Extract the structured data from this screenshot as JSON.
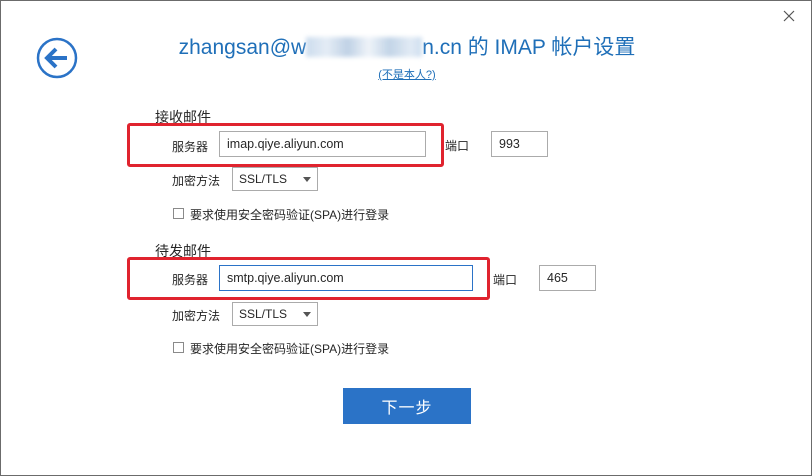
{
  "header": {
    "title_prefix": "zhangsan@w",
    "title_suffix": "n.cn 的 IMAP 帐户设置",
    "not_me_link": "(不是本人?)"
  },
  "incoming": {
    "section_title": "接收邮件",
    "server_label": "服务器",
    "server_value": "imap.qiye.aliyun.com",
    "port_label": "端口",
    "port_value": "993",
    "encryption_label": "加密方法",
    "encryption_value": "SSL/TLS",
    "spa_label": "要求使用安全密码验证(SPA)进行登录"
  },
  "outgoing": {
    "section_title": "待发邮件",
    "server_label": "服务器",
    "server_value": "smtp.qiye.aliyun.com",
    "port_label": "端口",
    "port_value": "465",
    "encryption_label": "加密方法",
    "encryption_value": "SSL/TLS",
    "spa_label": "要求使用安全密码验证(SPA)进行登录"
  },
  "footer": {
    "next_button": "下一步"
  },
  "colors": {
    "accent": "#2b73c7",
    "title": "#1f6fb8",
    "highlight": "#e0232e"
  },
  "icons": {
    "back": "back-arrow-circle-icon",
    "close": "close-icon"
  }
}
